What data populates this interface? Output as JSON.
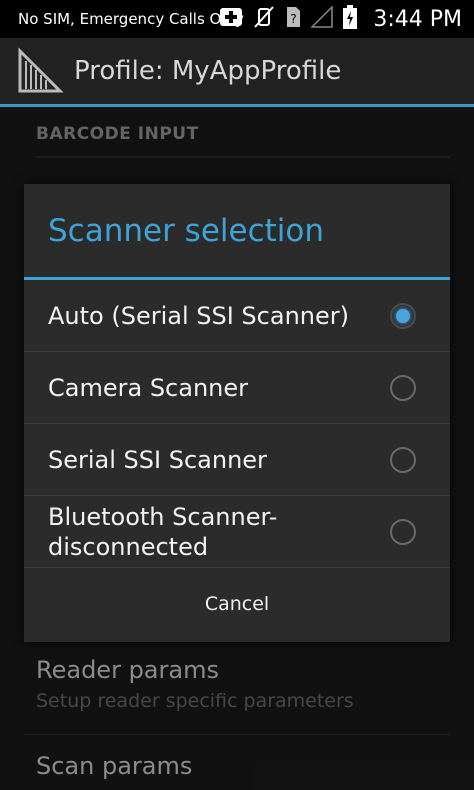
{
  "status_bar": {
    "carrier_text": "No SIM, Emergency Calls Only",
    "time": "3:44 PM",
    "icons": [
      "medical-plus-icon",
      "vibrate-off-icon",
      "no-sim-icon",
      "no-signal-icon",
      "battery-charging-icon"
    ]
  },
  "action_bar": {
    "title": "Profile: MyAppProfile",
    "icon": "barcode-app-icon"
  },
  "preferences": {
    "section_header": "BARCODE INPUT",
    "items": [
      {
        "title": "Reader params",
        "summary": "Setup reader specific parameters"
      },
      {
        "title": "Scan params",
        "summary": ""
      }
    ]
  },
  "dialog": {
    "title": "Scanner selection",
    "options": [
      {
        "label": "Auto (Serial SSI Scanner)",
        "selected": true
      },
      {
        "label": "Camera Scanner",
        "selected": false
      },
      {
        "label": "Serial SSI Scanner",
        "selected": false
      },
      {
        "label": "Bluetooth Scanner-disconnected",
        "selected": false
      }
    ],
    "cancel_label": "Cancel"
  },
  "colors": {
    "accent": "#3ea3d6",
    "dialog_bg": "#2b2b2b",
    "status_bar_bg": "#000000"
  }
}
